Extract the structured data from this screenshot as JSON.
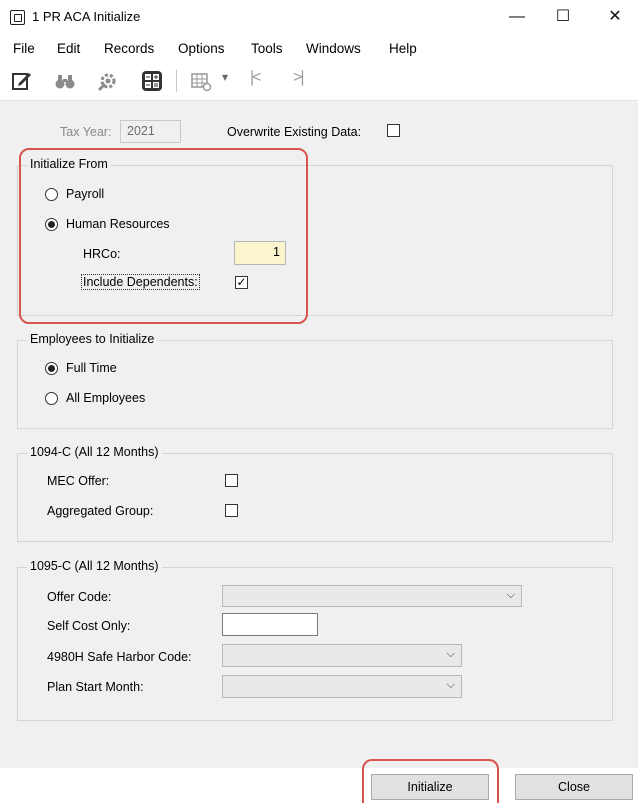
{
  "window": {
    "title": "1 PR ACA Initialize",
    "minimize": "—",
    "maximize": "☐",
    "close": "✕"
  },
  "menu": [
    "File",
    "Edit",
    "Records",
    "Options",
    "Tools",
    "Windows",
    "Help"
  ],
  "toolbar": {
    "icons": [
      "edit-icon",
      "binoculars-icon",
      "wrench-gear-icon",
      "calculator-icon",
      "grid-settings-icon",
      "dropdown-arrow-icon",
      "first-record-icon",
      "last-record-icon"
    ],
    "dropdown_arrow": "▾",
    "first": "|<",
    "last": ">|"
  },
  "top": {
    "tax_year_label": "Tax Year:",
    "tax_year_value": "2021",
    "overwrite_label": "Overwrite Existing Data:",
    "overwrite_checked": false
  },
  "initialize_from": {
    "legend": "Initialize From",
    "payroll_label": "Payroll",
    "hr_label": "Human Resources",
    "selected": "Human Resources",
    "hrco_label": "HRCo:",
    "hrco_value": "1",
    "include_dependents_label": "Include Dependents:",
    "include_dependents_checked": true,
    "check_glyph": "✓"
  },
  "employees": {
    "legend": "Employees to Initialize",
    "full_time_label": "Full Time",
    "all_label": "All Employees",
    "selected": "Full Time"
  },
  "form_1094c": {
    "legend": "1094-C (All 12 Months)",
    "mec_label": "MEC Offer:",
    "mec_checked": false,
    "aggregated_label": "Aggregated Group:",
    "aggregated_checked": false
  },
  "form_1095c": {
    "legend": "1095-C (All 12 Months)",
    "offer_code_label": "Offer Code:",
    "offer_code_value": "",
    "self_cost_label": "Self Cost Only:",
    "self_cost_value": "",
    "safe_harbor_label": "4980H Safe Harbor Code:",
    "safe_harbor_value": "",
    "plan_start_label": "Plan Start Month:",
    "plan_start_value": "",
    "chevron": "⌵"
  },
  "buttons": {
    "initialize": "Initialize",
    "close": "Close"
  },
  "colors": {
    "highlight": "#d7554c",
    "hrco_bg": "#fbf5cf"
  }
}
